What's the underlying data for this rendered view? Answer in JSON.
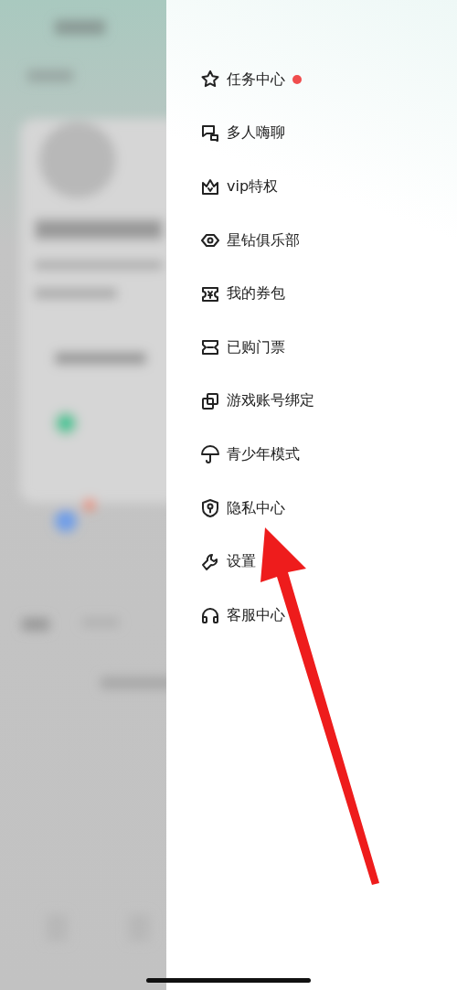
{
  "drawer": {
    "items": [
      {
        "label": "任务中心",
        "badge": true
      },
      {
        "label": "多人嗨聊",
        "badge": false
      },
      {
        "label": "vip特权",
        "badge": false
      },
      {
        "label": "星钻俱乐部",
        "badge": false
      },
      {
        "label": "我的券包",
        "badge": false
      },
      {
        "label": "已购门票",
        "badge": false
      },
      {
        "label": "游戏账号绑定",
        "badge": false
      },
      {
        "label": "青少年模式",
        "badge": false
      },
      {
        "label": "隐私中心",
        "badge": false
      },
      {
        "label": "设置",
        "badge": false
      },
      {
        "label": "客服中心",
        "badge": false
      }
    ]
  }
}
